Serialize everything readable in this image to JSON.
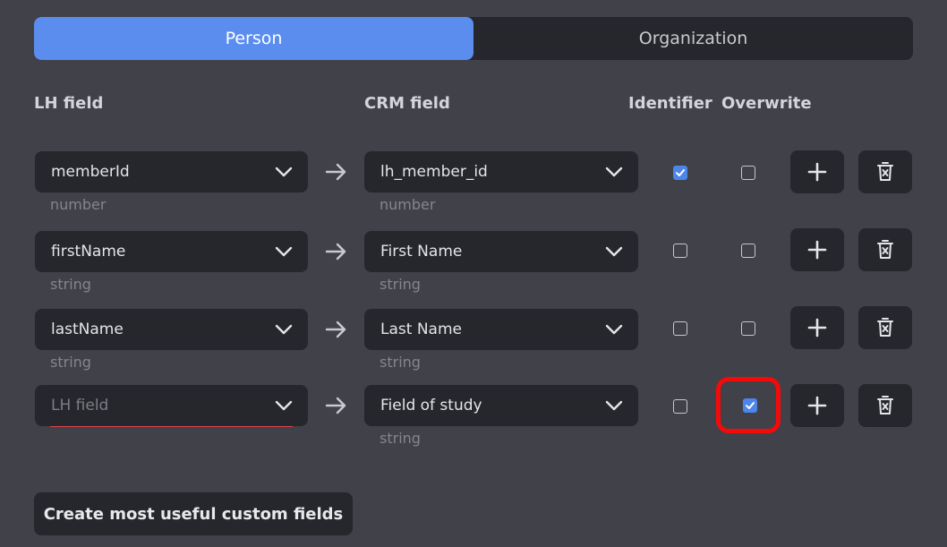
{
  "tabs": [
    {
      "label": "Person",
      "active": true
    },
    {
      "label": "Organization",
      "active": false
    }
  ],
  "headers": {
    "lh_field": "LH field",
    "crm_field": "CRM field",
    "identifier": "Identifier",
    "overwrite": "Overwrite"
  },
  "rows": [
    {
      "lh_value": "memberId",
      "lh_type": "number",
      "crm_value": "lh_member_id",
      "crm_type": "number",
      "identifier": true,
      "overwrite": false
    },
    {
      "lh_value": "firstName",
      "lh_type": "string",
      "crm_value": "First Name",
      "crm_type": "string",
      "identifier": false,
      "overwrite": false
    },
    {
      "lh_value": "lastName",
      "lh_type": "string",
      "crm_value": "Last Name",
      "crm_type": "string",
      "identifier": false,
      "overwrite": false
    },
    {
      "lh_value": "",
      "lh_placeholder": "LH field",
      "lh_type": "",
      "crm_value": "Field of study",
      "crm_type": "string",
      "identifier": false,
      "overwrite": true,
      "overwrite_highlighted": true
    }
  ],
  "create_button_label": "Create most useful custom fields",
  "icons": {
    "dropdown": "chevron-down-icon",
    "arrow": "arrow-right-icon",
    "add": "plus-icon",
    "delete": "trash-icon",
    "check": "check-icon"
  },
  "colors": {
    "accent": "#5b8def",
    "checkbox_checked": "#4d86ea",
    "highlight": "#f50a0a",
    "error_underline": "#e0454a"
  }
}
